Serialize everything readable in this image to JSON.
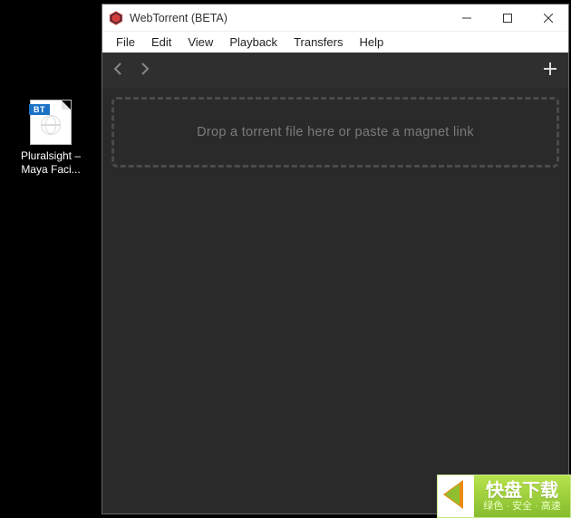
{
  "desktop": {
    "file": {
      "badge": "BT",
      "label_line1": "Pluralsight –",
      "label_line2": "Maya Faci..."
    }
  },
  "app": {
    "title": "WebTorrent (BETA)",
    "menu": {
      "file": "File",
      "edit": "Edit",
      "view": "View",
      "playback": "Playback",
      "transfers": "Transfers",
      "help": "Help"
    },
    "dropzone_text": "Drop a torrent file here or paste a magnet link"
  },
  "watermark": {
    "main": "快盘下载",
    "sub": "绿色 · 安全 · 高速"
  }
}
